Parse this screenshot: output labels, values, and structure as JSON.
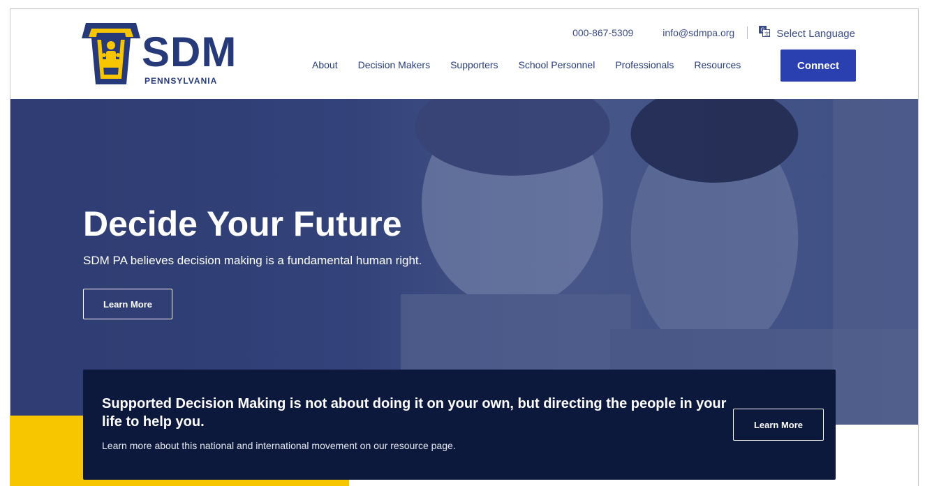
{
  "brand": {
    "name": "SDM",
    "subtitle": "PENNSYLVANIA",
    "navy": "#263a7a",
    "accent_blue": "#2a3fb0",
    "yellow": "#f7c600"
  },
  "topbar": {
    "phone": "000-867-5309",
    "email": "info@sdmpa.org",
    "language": "Select Language",
    "language_icon": "translate-icon"
  },
  "nav": {
    "items": [
      "About",
      "Decision Makers",
      "Supporters",
      "School Personnel",
      "Professionals",
      "Resources"
    ],
    "connect": "Connect"
  },
  "hero": {
    "title": "Decide Your Future",
    "subtitle": "SDM PA believes decision making is a fundamental human right.",
    "button": "Learn More"
  },
  "callout": {
    "headline": "Supported Decision Making is not about doing it on your own, but directing the people in your life to help you.",
    "subtext": "Learn more about this national and international movement on our resource page.",
    "button": "Learn More"
  }
}
